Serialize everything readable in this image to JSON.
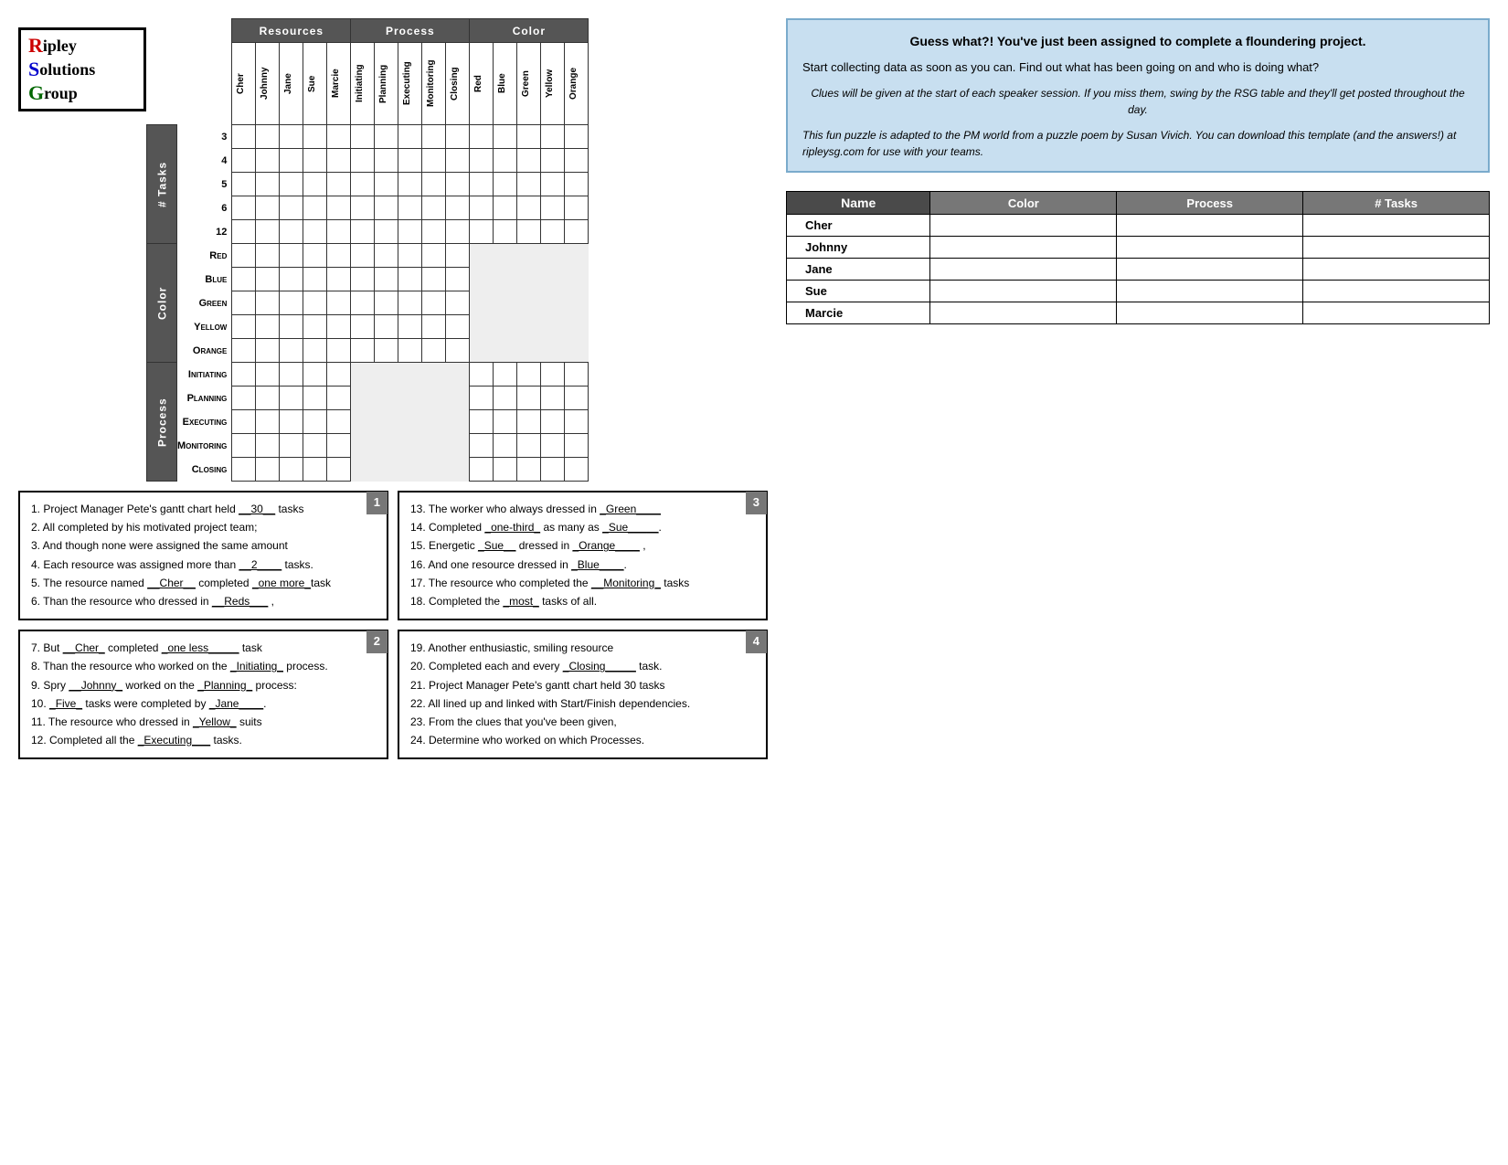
{
  "logo": {
    "line1": "ipley",
    "line2": "olutions",
    "line3": "roup",
    "r": "R",
    "s": "S",
    "g": "G"
  },
  "grid": {
    "resources_label": "Resources",
    "process_label": "Process",
    "color_label": "Color",
    "col_headers": [
      "Cher",
      "Johnny",
      "Jane",
      "Sue",
      "Marcie",
      "Initiating",
      "Planning",
      "Executing",
      "Monitoring",
      "Closing",
      "Red",
      "Blue",
      "Green",
      "Yellow",
      "Orange"
    ],
    "row_sections": {
      "tasks": {
        "label": "# Tasks",
        "rows": [
          "3",
          "4",
          "5",
          "6",
          "12"
        ]
      },
      "color": {
        "label": "Color",
        "rows": [
          "Red",
          "Blue",
          "Green",
          "Yellow",
          "Orange"
        ]
      },
      "process": {
        "label": "Process",
        "rows": [
          "Initiating",
          "Planning",
          "Executing",
          "Monitoring",
          "Closing"
        ]
      }
    }
  },
  "summary_table": {
    "headers": [
      "Name",
      "Color",
      "Process",
      "# Tasks"
    ],
    "rows": [
      {
        "name": "Cher"
      },
      {
        "name": "Johnny"
      },
      {
        "name": "Jane"
      },
      {
        "name": "Sue"
      },
      {
        "name": "Marcie"
      }
    ]
  },
  "info_box": {
    "title": "Guess what?! You've just been assigned to complete a floundering project.",
    "body": "Start collecting data as soon as you can.  Find out what has been going on and who is doing what?",
    "clue_note": "Clues will be given at the start of each speaker session.  If you miss them, swing by the RSG table and they'll get posted throughout the day.",
    "footer": "This fun puzzle is adapted to the PM world from a puzzle poem by Susan Vivich.  You can download this template (and the answers!) at ripleysg.com for use with your teams."
  },
  "clue_boxes": {
    "box1": {
      "number": "1",
      "clues": [
        "1.  Project Manager Pete's gantt chart held __30__ tasks",
        "2.  All completed by his motivated project team;",
        "3.  And though none were assigned the same amount",
        "4.  Each resource was assigned more than __2____ tasks.",
        "5.  The resource named __Cher__ completed _one more_task",
        "6.  Than the resource who dressed in __Reds___ ,"
      ]
    },
    "box2": {
      "number": "2",
      "clues": [
        "7.  But __Cher_ completed _one less_____ task",
        "8.  Than the resource who worked on the _Initiating_ process.",
        "9.  Spry __Johnny_ worked on the _Planning_ process:",
        "10. _Five_ tasks were completed by _Jane____.",
        "11. The resource who dressed in _Yellow_ suits",
        "12. Completed all the _Executing___ tasks."
      ]
    },
    "box3": {
      "number": "3",
      "clues": [
        "13. The worker who always dressed in _Green____",
        "14. Completed _one-third_ as many as _Sue_____.",
        "15. Energetic _Sue__ dressed in _Orange____ ,",
        "16. And one resource dressed in _Blue____.",
        "17. The resource who completed the __Monitoring_ tasks",
        "18. Completed the _most_ tasks of all."
      ]
    },
    "box4": {
      "number": "4",
      "clues": [
        "19. Another enthusiastic, smiling resource",
        "20. Completed each and every _Closing____ task.",
        "21. Project Manager Pete's gantt chart held 30 tasks",
        "22. All lined up and linked with Start/Finish dependencies.",
        "23. From the clues that you've been given,",
        "24. Determine who worked on which Processes."
      ]
    }
  }
}
